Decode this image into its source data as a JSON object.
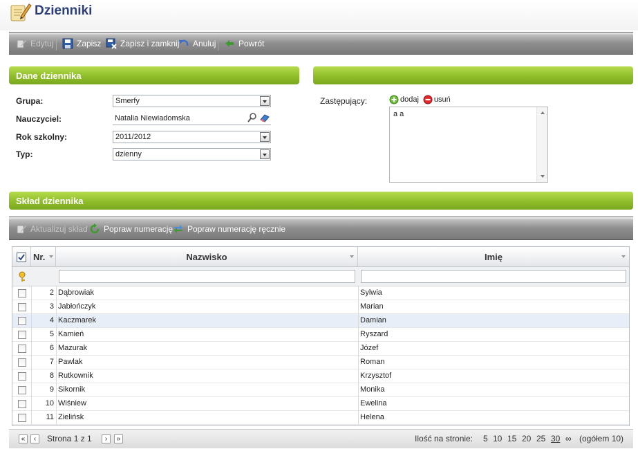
{
  "header": {
    "title": "Dzienniki"
  },
  "toolbar": {
    "edit": "Edytuj",
    "save": "Zapisz",
    "save_close": "Zapisz i zamknij",
    "cancel": "Anuluj",
    "back": "Powrót"
  },
  "journal_section": {
    "title": "Dane dziennika"
  },
  "form": {
    "group_label": "Grupa:",
    "group_value": "Smerfy",
    "teacher_label": "Nauczyciel:",
    "teacher_value": "Natalia Niewiadomska",
    "year_label": "Rok szkolny:",
    "year_value": "2011/2012",
    "type_label": "Typ:",
    "type_value": "dzienny"
  },
  "substitutes": {
    "label": "Zastępujący:",
    "add": "dodaj",
    "remove": "usuń",
    "items": [
      "a a"
    ]
  },
  "composition_section": {
    "title": "Skład dziennika"
  },
  "subtoolbar": {
    "update": "Aktualizuj skład",
    "fix_numbering": "Popraw numerację",
    "fix_numbering_manual": "Popraw numerację ręcznie"
  },
  "grid": {
    "columns": {
      "nr": "Nr.",
      "surname": "Nazwisko",
      "name": "Imię"
    },
    "rows": [
      {
        "nr": "2",
        "surname": "Dąbrowiak",
        "name": "Sylwia"
      },
      {
        "nr": "3",
        "surname": "Jabłończyk",
        "name": "Marian"
      },
      {
        "nr": "4",
        "surname": "Kaczmarek",
        "name": "Damian"
      },
      {
        "nr": "5",
        "surname": "Kamień",
        "name": "Ryszard"
      },
      {
        "nr": "6",
        "surname": "Mazurak",
        "name": "Józef"
      },
      {
        "nr": "7",
        "surname": "Pawlak",
        "name": "Roman"
      },
      {
        "nr": "8",
        "surname": "Rutkownik",
        "name": "Krzysztof"
      },
      {
        "nr": "9",
        "surname": "Sikornik",
        "name": "Monika"
      },
      {
        "nr": "10",
        "surname": "Wiśniew",
        "name": "Ewelina"
      },
      {
        "nr": "11",
        "surname": "Zielińsk",
        "name": "Helena"
      }
    ],
    "highlighted_row": 2
  },
  "pager": {
    "page_text": "Strona 1 z 1",
    "per_page_label": "Ilość na stronie:",
    "sizes": [
      "5",
      "10",
      "15",
      "20",
      "25",
      "30",
      "∞"
    ],
    "active_size": "30",
    "total": "(ogółem 10)"
  },
  "colors": {
    "accent_green": "#8fbd2a",
    "toolbar_gray": "#8e8e8e",
    "title_blue": "#2c3f7a"
  }
}
